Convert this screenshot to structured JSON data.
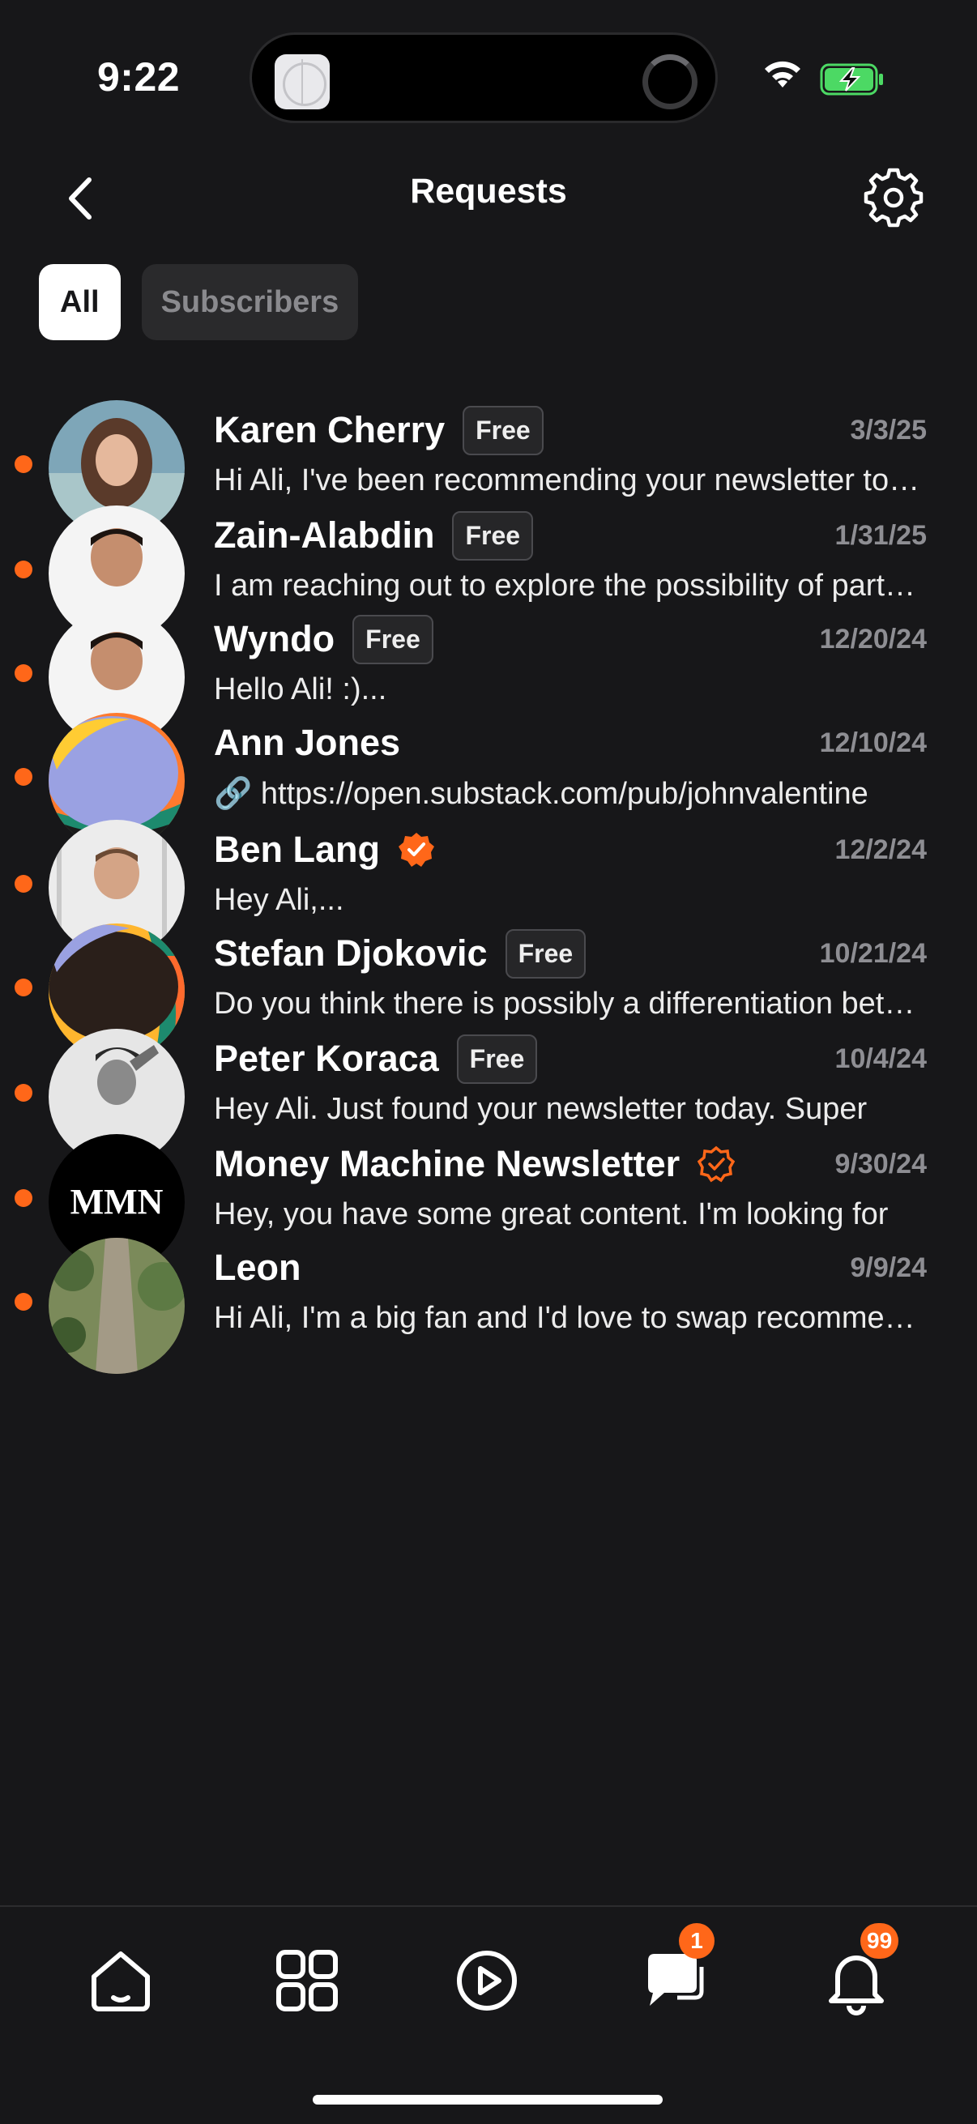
{
  "status_bar": {
    "time": "9:22"
  },
  "header": {
    "title": "Requests"
  },
  "filters": [
    {
      "label": "All",
      "active": true
    },
    {
      "label": "Subscribers",
      "active": false
    }
  ],
  "accent_color": "#ff6719",
  "requests": [
    {
      "name": "Karen Cherry",
      "badge": "Free",
      "verified": false,
      "date": "3/3/25",
      "preview": "Hi Ali, I've been recommending your newsletter to my readers and I'd love to connect",
      "unread": true,
      "avatar": "photo-woman"
    },
    {
      "name": "Zain-Alabdin",
      "badge": "Free",
      "verified": false,
      "date": "1/31/25",
      "preview": "I am reaching out to explore the possibility of partnering",
      "unread": true,
      "avatar": "photo-man"
    },
    {
      "name": "Wyndo",
      "badge": "Free",
      "verified": false,
      "date": "12/20/24",
      "preview": "Hello Ali! :)...",
      "unread": true,
      "avatar": "photo-man"
    },
    {
      "name": "Ann Jones",
      "badge": "",
      "verified": false,
      "date": "12/10/24",
      "preview": "🔗 https://open.substack.com/pub/johnvalentine",
      "unread": true,
      "avatar": "abstract-blue"
    },
    {
      "name": "Ben Lang",
      "badge": "",
      "verified": true,
      "verified_style": "filled",
      "date": "12/2/24",
      "preview": "Hey Ali,...",
      "unread": true,
      "avatar": "photo-man-light"
    },
    {
      "name": "Stefan Djokovic",
      "badge": "Free",
      "verified": false,
      "date": "10/21/24",
      "preview": "Do you think there is possibly a differentiation between",
      "unread": true,
      "avatar": "abstract-dark"
    },
    {
      "name": "Peter Koraca",
      "badge": "Free",
      "verified": false,
      "date": "10/4/24",
      "preview": "Hey Ali. Just found your newsletter today. Super",
      "unread": true,
      "avatar": "photo-bw"
    },
    {
      "name": "Money Machine Newsletter",
      "badge": "",
      "verified": true,
      "verified_style": "outline",
      "date": "9/30/24",
      "preview": "Hey, you have some great content. I'm looking for",
      "unread": true,
      "avatar": "logo-mmn",
      "avatar_text": "MMN"
    },
    {
      "name": "Leon",
      "badge": "",
      "verified": false,
      "date": "9/9/24",
      "preview": "Hi Ali, I'm a big fan and I'd love to swap recommendations",
      "unread": true,
      "avatar": "photo-garden"
    }
  ],
  "tabbar": {
    "items": [
      {
        "name": "home-icon"
      },
      {
        "name": "grid-icon"
      },
      {
        "name": "play-icon"
      },
      {
        "name": "chat-icon",
        "badge": "1"
      },
      {
        "name": "bell-icon",
        "badge": "99"
      }
    ]
  }
}
